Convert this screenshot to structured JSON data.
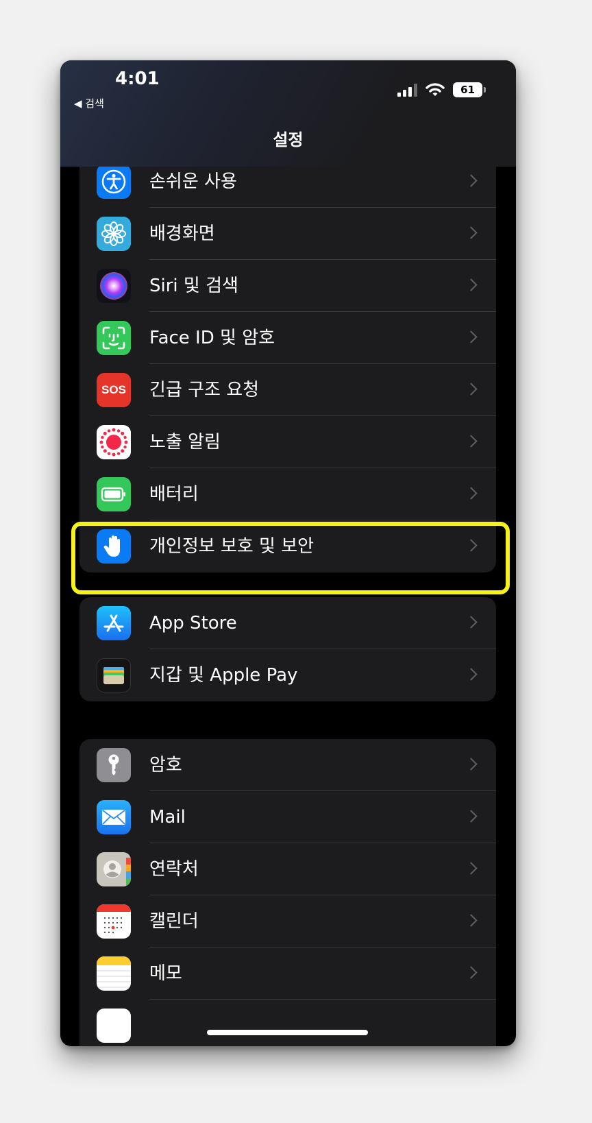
{
  "status_bar": {
    "time": "4:01",
    "back_label": "◀ 검색",
    "battery": "61"
  },
  "header": {
    "title": "설정"
  },
  "groups": [
    {
      "items": [
        {
          "label": "손쉬운 사용",
          "icon": "accessibility-icon",
          "color": "#0a7af5"
        },
        {
          "label": "배경화면",
          "icon": "wallpaper-flower-icon",
          "color": "#35aadc"
        },
        {
          "label": "Siri 및 검색",
          "icon": "siri-icon",
          "color": "#1a1a2e"
        },
        {
          "label": "Face ID 및 암호",
          "icon": "face-id-icon",
          "color": "#34c759"
        },
        {
          "label": "긴급 구조 요청",
          "icon": "sos-icon",
          "color": "#e5352b",
          "icon_text": "SOS"
        },
        {
          "label": "노출 알림",
          "icon": "exposure-notification-icon",
          "color": "#ffffff"
        },
        {
          "label": "배터리",
          "icon": "battery-icon",
          "color": "#34c759"
        },
        {
          "label": "개인정보 보호 및 보안",
          "icon": "privacy-hand-icon",
          "color": "#0a7af5",
          "highlighted": true
        }
      ]
    },
    {
      "items": [
        {
          "label": "App Store",
          "icon": "app-store-icon",
          "color": "#1a8cf5"
        },
        {
          "label": "지갑 및 Apple Pay",
          "icon": "wallet-icon",
          "color": "#2c2c2e"
        }
      ]
    },
    {
      "items": [
        {
          "label": "암호",
          "icon": "key-icon",
          "color": "#8e8e93"
        },
        {
          "label": "Mail",
          "icon": "mail-icon",
          "color": "#1f8ef5"
        },
        {
          "label": "연락처",
          "icon": "contacts-icon",
          "color": "#c8c5bd"
        },
        {
          "label": "캘린더",
          "icon": "calendar-icon",
          "color": "#ffffff"
        },
        {
          "label": "메모",
          "icon": "notes-icon",
          "color": "#ffffff"
        },
        {
          "label": "",
          "icon": "reminders-icon",
          "color": "#ffffff"
        }
      ]
    }
  ]
}
